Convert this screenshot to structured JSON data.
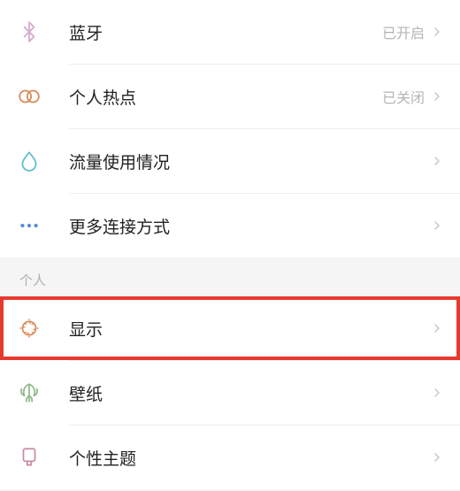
{
  "connectivity": {
    "bluetooth": {
      "label": "蓝牙",
      "status": "已开启"
    },
    "hotspot": {
      "label": "个人热点",
      "status": "已关闭"
    },
    "data_usage": {
      "label": "流量使用情况"
    },
    "more_connections": {
      "label": "更多连接方式"
    }
  },
  "personal": {
    "header": "个人",
    "display": {
      "label": "显示"
    },
    "wallpaper": {
      "label": "壁纸"
    },
    "themes": {
      "label": "个性主题"
    }
  },
  "colors": {
    "bluetooth_icon": "#d4a9cc",
    "hotspot_icon": "#d88a55",
    "data_icon": "#5fbcc8",
    "more_icon": "#5a8fd4",
    "display_icon": "#d88a55",
    "wallpaper_icon": "#8fb88a",
    "themes_icon": "#c88aa8",
    "chevron": "#c7c7cc"
  }
}
